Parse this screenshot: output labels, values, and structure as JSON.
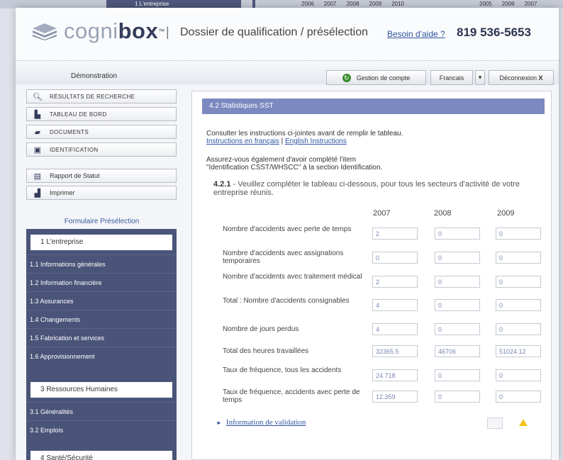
{
  "top_strip": {
    "label": "1 L'entreprise",
    "years_a": [
      "2006",
      "2007",
      "2008",
      "2009",
      "2010"
    ],
    "years_b": [
      "2005",
      "2006",
      "2007"
    ]
  },
  "header": {
    "logo_part1": "cogni",
    "logo_part2": "box",
    "logo_tm": "™",
    "separator": "|",
    "title": "Dossier de qualification / présélection",
    "help_link": "Besoin d'aide ?",
    "phone": "819 536-5653"
  },
  "toolbar": {
    "demo_label": "Démonstration",
    "account_button": "Gestion de compte",
    "language_select": "Francais",
    "language_arrow": "▾",
    "logout_button": "Déconnexion",
    "logout_x": "X"
  },
  "sidebar": {
    "top_buttons": [
      {
        "label": "RÉSULTATS DE RECHERCHE",
        "icon": "search-icon"
      },
      {
        "label": "TABLEAU DE BORD",
        "icon": "bar-chart-icon"
      },
      {
        "label": "DOCUMENTS",
        "icon": "folder-icon"
      },
      {
        "label": "IDENTIFICATION",
        "icon": "id-card-icon"
      }
    ],
    "tool_buttons": [
      {
        "label": "Rapport de Statut",
        "icon": "document-icon"
      },
      {
        "label": "Imprimer",
        "icon": "printer-icon"
      }
    ],
    "form_heading": "Formulaire Présélection",
    "section1": {
      "title": "1 L'entreprise",
      "items": [
        "1.1 Informations générales",
        "1.2 Information financière",
        "1.3 Assurances",
        "1.4 Changements",
        "1.5 Fabrication et services",
        "1.6 Approvisionnement"
      ]
    },
    "section3": {
      "title": "3 Ressources Humaines",
      "items": [
        "3.1 Généralités",
        "3.2 Emplois"
      ]
    },
    "section4": {
      "title": "4 Santé/Sécurité"
    }
  },
  "main": {
    "section_title": "4.2 Statistiques SST",
    "intro_line": "Consulter les instructions ci-jointes avant de remplir le tableau.",
    "link_fr": "Instructions en français",
    "link_sep": " | ",
    "link_en": "English Instructions",
    "note_line1": "Assurez-vous également d'avoir complété l'item",
    "note_line2": "\"Identification CSST/WHSCC\" à la section Identification.",
    "question_num": "4.2.1",
    "question_text": " - Veuillez compléter le tableau ci-dessous, pour tous les secteurs d'activité de votre entreprise réunis.",
    "years": [
      "2007",
      "2008",
      "2009"
    ],
    "rows": [
      {
        "label": "Nombre d'accidents avec perte de temps",
        "values": [
          "2",
          "0",
          "0"
        ]
      },
      {
        "label": "Nombre d'accidents avec assignations temporaires",
        "values": [
          "0",
          "0",
          "0"
        ]
      },
      {
        "label": "Nombre d'accidents avec traitement médical",
        "values": [
          "2",
          "0",
          "0"
        ]
      },
      {
        "label": "Total : Nombre d'accidents consignables",
        "values": [
          "4",
          "0",
          "0"
        ]
      },
      {
        "label": "Nombre de jours perdus",
        "values": [
          "4",
          "0",
          "0"
        ]
      },
      {
        "label": "Total des heures travaillées",
        "values": [
          "32365.5",
          "46706",
          "51024.12"
        ]
      },
      {
        "label": "Taux de fréquence, tous les accidents",
        "values": [
          "24.718",
          "0",
          "0"
        ]
      },
      {
        "label": "Taux de fréquence, accidents avec perte de temps",
        "values": [
          "12.359",
          "0",
          "0"
        ]
      }
    ],
    "validation_arrow": "►",
    "validation_link": "Information de validation"
  }
}
